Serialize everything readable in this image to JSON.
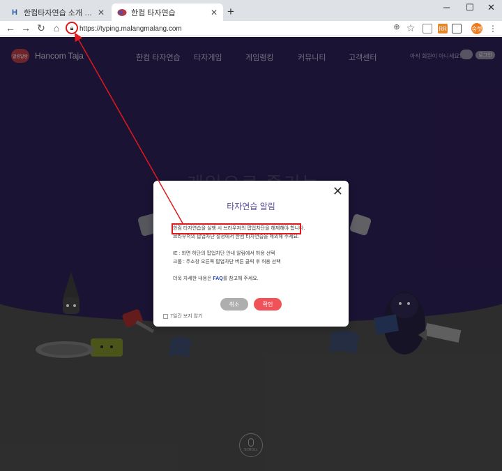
{
  "browser": {
    "tabs": [
      {
        "title": "한컴타자연습 소개 : 한글과컴퓨",
        "icon": "hancom-h-icon",
        "active": false
      },
      {
        "title": "한컴 타자연습",
        "icon": "taja-favicon",
        "active": true
      }
    ],
    "new_tab": "+",
    "url": "https://typing.malangmalang.com",
    "profile_label": "숨렛"
  },
  "site": {
    "logo_text": "Hancom Taja",
    "logo_mark_text": "말랑말랑",
    "nav": [
      "한컴 타자연습",
      "타자게임",
      "게임랭킹",
      "커뮤니티",
      "고객센터"
    ],
    "guest_text": "아직 회원이 아니세요?",
    "login_label": "로그인",
    "hero_text": "게임으로 즐기는",
    "scroll_label": "SCROLL"
  },
  "modal": {
    "title": "타자연습 알림",
    "lines": [
      "한컴 타자연습을 실행 시 브라우저의 팝업차단을 해제해야 합니다.",
      "브라우저의 팝업차단 설정에서 한컴 타자연습을 제외해 주세요.",
      "IE : 화면 하단의 팝업차단 안내 알림에서 허용 선택",
      "크롬 : 주소창 오른쪽 팝업차단 버튼 클릭 후 허용 선택"
    ],
    "faq_prefix": "더욱 자세한 내용은 ",
    "faq_link": "FAQ",
    "faq_suffix": "를 참고해 주세요.",
    "cancel_label": "취소",
    "ok_label": "확인",
    "dont_show_label": "7일간 보지 않기"
  },
  "colors": {
    "site_bg": "#2d1f54",
    "accent_purple": "#5c4ba0",
    "ok_button": "#f0525a",
    "annotation_red": "#e0191d"
  }
}
